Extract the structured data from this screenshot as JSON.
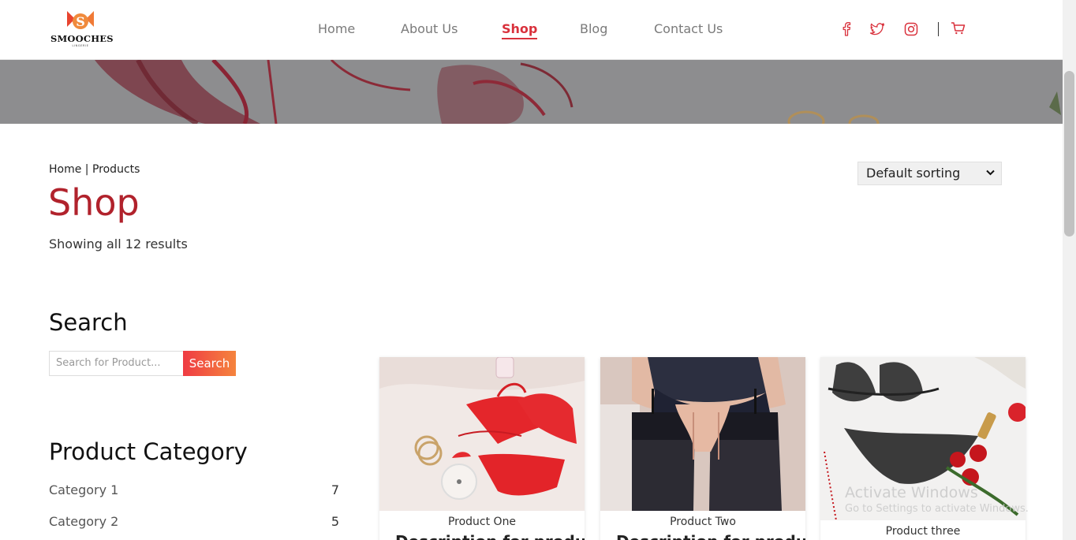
{
  "brand": {
    "name": "SMOOCHES",
    "tagline": "LINGERIE",
    "accent": "#d9313c",
    "title_color": "#b1222c"
  },
  "nav": {
    "items": [
      {
        "label": "Home",
        "active": false
      },
      {
        "label": "About Us",
        "active": false
      },
      {
        "label": "Shop",
        "active": true
      },
      {
        "label": "Blog",
        "active": false
      },
      {
        "label": "Contact Us",
        "active": false
      }
    ],
    "social_icons": [
      "facebook-icon",
      "twitter-icon",
      "instagram-icon"
    ],
    "cart_icon": "cart-icon"
  },
  "breadcrumb": {
    "home": "Home",
    "separator": " | ",
    "current": "Products"
  },
  "page": {
    "title": "Shop",
    "results": "Showing all 12 results"
  },
  "sort": {
    "selected": "Default sorting"
  },
  "sidebar": {
    "search": {
      "title": "Search",
      "placeholder": "Search for Product...",
      "button": "Search"
    },
    "categories": {
      "title": "Product Category",
      "items": [
        {
          "label": "Category 1",
          "count": "7"
        },
        {
          "label": "Category 2",
          "count": "5"
        }
      ]
    }
  },
  "products": [
    {
      "name": "Product One",
      "desc": "Description for product"
    },
    {
      "name": "Product Two",
      "desc": "Description for product"
    },
    {
      "name": "Product three",
      "desc": ""
    }
  ],
  "watermark": {
    "line1": "Activate Windows",
    "line2": "Go to Settings to activate Windows."
  }
}
